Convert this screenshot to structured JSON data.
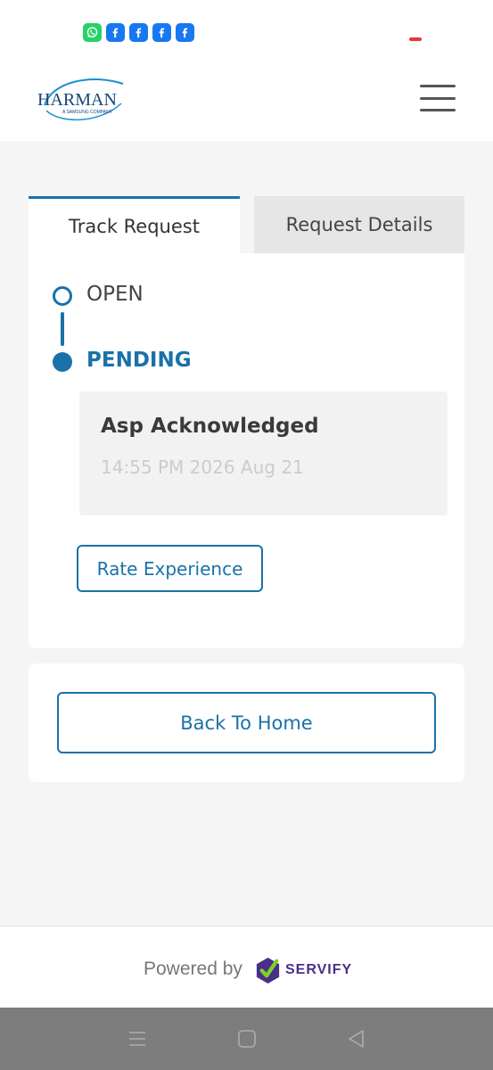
{
  "status_bar": {
    "icons": [
      "whatsapp-icon",
      "facebook-icon",
      "facebook-icon",
      "facebook-icon",
      "facebook-icon"
    ]
  },
  "header": {
    "logo_brand": "HARMAN",
    "logo_tagline": "A SAMSUNG COMPANY",
    "menu_icon": "hamburger-icon"
  },
  "tabs": [
    {
      "label": "Track Request",
      "active": true
    },
    {
      "label": "Request Details",
      "active": false
    }
  ],
  "timeline": {
    "steps": [
      {
        "label": "OPEN",
        "state": "done"
      },
      {
        "label": "PENDING",
        "state": "current"
      }
    ],
    "update": {
      "title": "Asp Acknowledged",
      "time": "14:55 PM 2026 Aug 21"
    }
  },
  "actions": {
    "rate_label": "Rate Experience",
    "home_label": "Back To Home"
  },
  "footer": {
    "powered_by": "Powered by",
    "brand": "SERVIFY"
  },
  "colors": {
    "accent": "#1a72a8",
    "background": "#f5f5f5",
    "servify_purple": "#4a2e8a",
    "servify_check": "#7ed321"
  },
  "nav_bar": {
    "icons": [
      "recent-apps-icon",
      "home-icon",
      "back-icon"
    ]
  }
}
